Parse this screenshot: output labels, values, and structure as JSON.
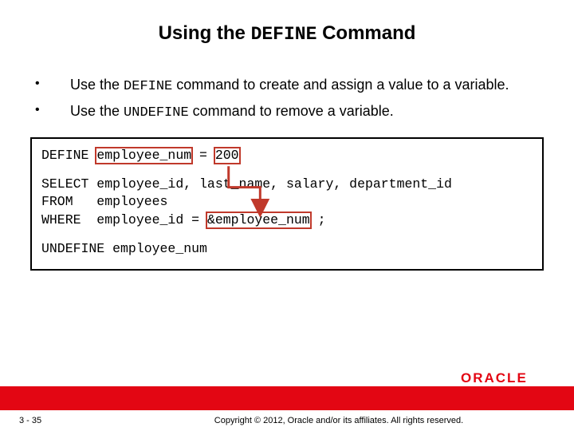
{
  "title": {
    "before": "Using the ",
    "code": "DEFINE",
    "after": " Command"
  },
  "bullets": [
    {
      "before": "Use the ",
      "code": "DEFINE",
      "after": " command to create and assign a value to a variable."
    },
    {
      "before": "Use the ",
      "code": "UNDEFINE",
      "after": " command to remove a variable."
    }
  ],
  "code": {
    "l1_kw": "DEFINE ",
    "l1_var": "employee_num",
    "l1_mid": " = ",
    "l1_val": "200",
    "l2": "SELECT employee_id, last_name, salary, department_id",
    "l3": "FROM   employees",
    "l4_a": "WHERE  employee_id = ",
    "l4_ref": "&employee_num",
    "l4_b": " ;",
    "l5": "UNDEFINE employee_num"
  },
  "logo": "ORACLE",
  "footer": {
    "page": "3 - 35",
    "copyright": "Copyright © 2012, Oracle and/or its affiliates. All rights reserved."
  }
}
